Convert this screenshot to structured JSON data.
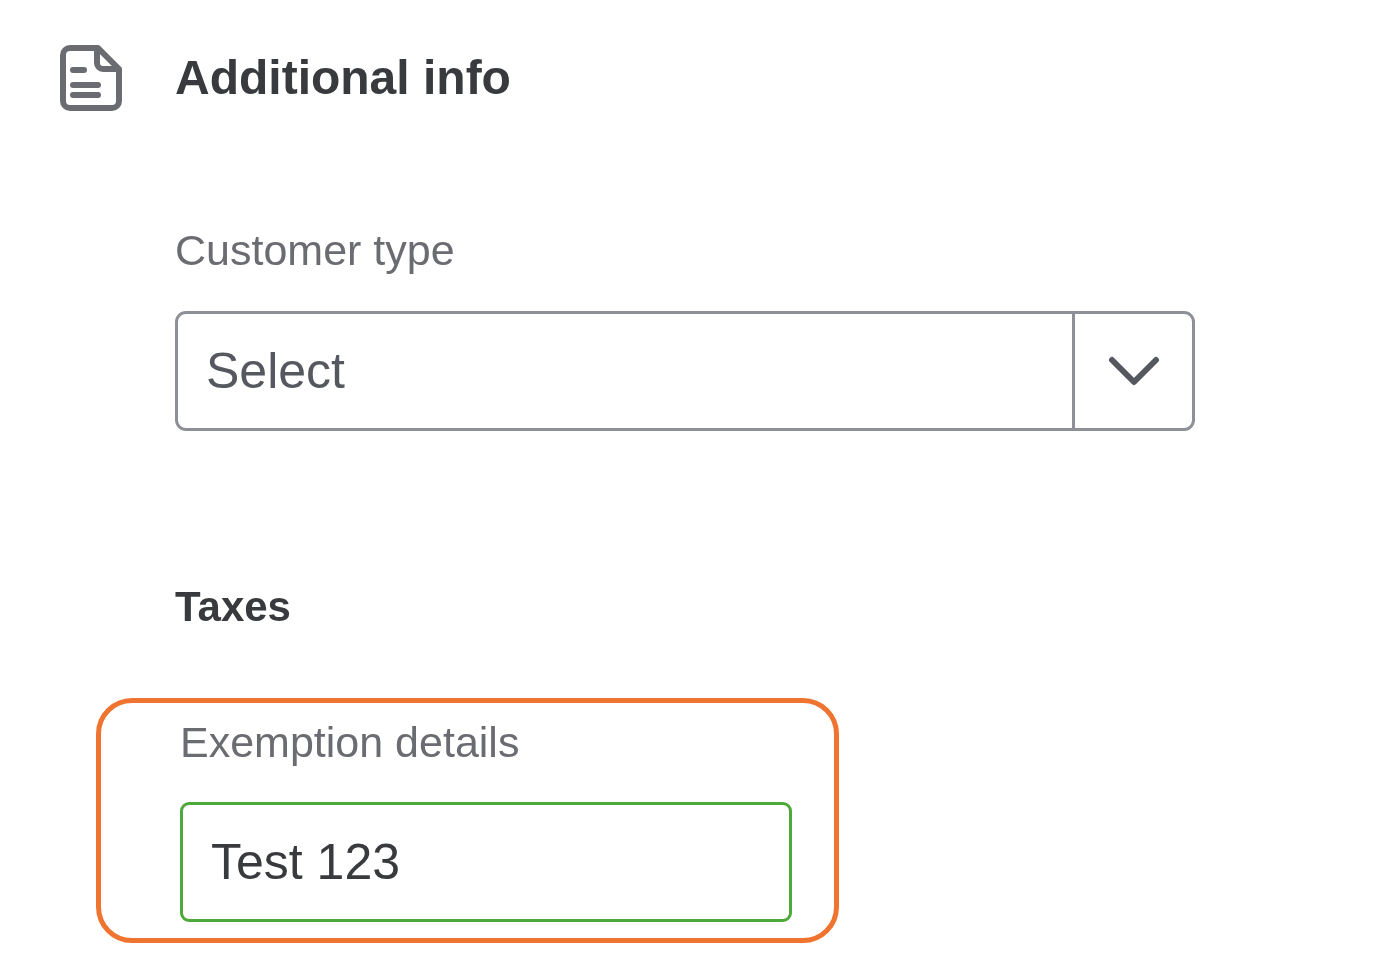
{
  "section": {
    "title": "Additional info"
  },
  "customer_type": {
    "label": "Customer type",
    "placeholder": "Select"
  },
  "taxes": {
    "heading": "Taxes"
  },
  "exemption_details": {
    "label": "Exemption details",
    "value": "Test 123",
    "focused": true,
    "highlighted": true
  }
}
